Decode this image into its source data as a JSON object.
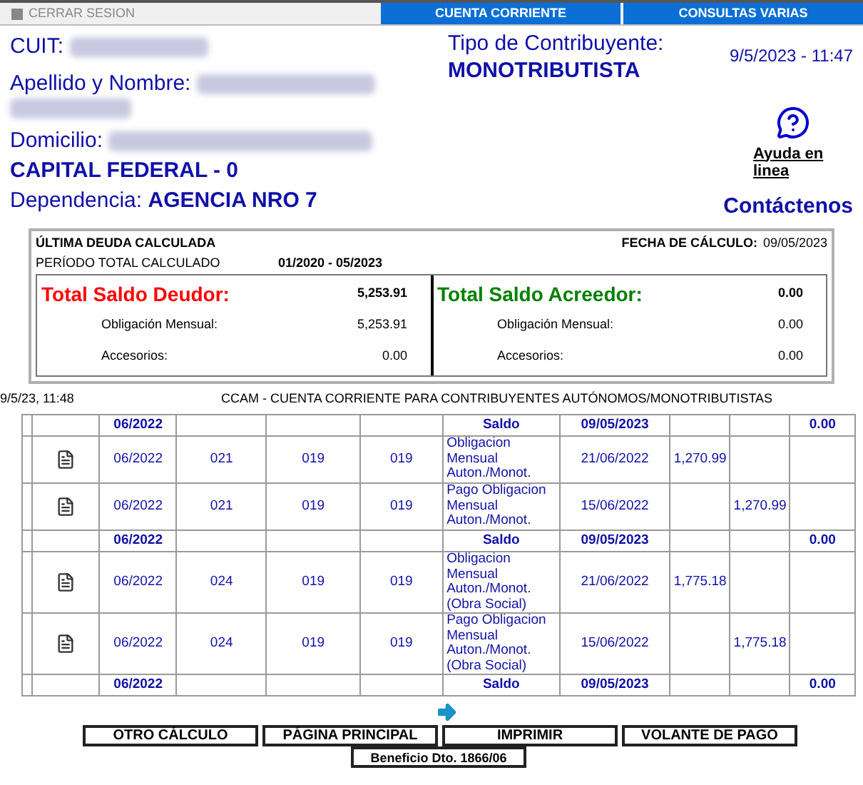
{
  "top_bar": {
    "logout": "CERRAR SESION",
    "tabs": [
      "CUENTA CORRIENTE",
      "CONSULTAS VARIAS"
    ]
  },
  "header": {
    "cuit_label": "CUIT:",
    "tipo_label": "Tipo de Contribuyente:",
    "tipo_value": "MONOTRIBUTISTA",
    "datetime": "9/5/2023 - 11:47",
    "nombre_label": "Apellido y Nombre:",
    "domicilio_label": "Domicilio:",
    "domicilio_city": "CAPITAL FEDERAL - 0",
    "help_link": "Ayuda en linea",
    "dependencia_label": "Dependencia:",
    "dependencia_value": "AGENCIA NRO 7",
    "contact_link": "Contáctenos"
  },
  "summary": {
    "title": "ÚLTIMA DEUDA CALCULADA",
    "date_label": "FECHA DE CÁLCULO:",
    "date_value": "09/05/2023",
    "period_label": "PERÍODO TOTAL CALCULADO",
    "period_value": "01/2020 - 05/2023",
    "panels": [
      {
        "title": "Total Saldo Deudor:",
        "color": "#ff0000",
        "total": "5,253.91",
        "lines": [
          {
            "label": "Obligación Mensual:",
            "value": "5,253.91"
          },
          {
            "label": "Accesorios:",
            "value": "0.00"
          }
        ]
      },
      {
        "title": "Total Saldo Acreedor:",
        "color": "#008000",
        "total": "0.00",
        "lines": [
          {
            "label": "Obligación Mensual:",
            "value": "0.00"
          },
          {
            "label": "Accesorios:",
            "value": "0.00"
          }
        ]
      }
    ]
  },
  "report": {
    "printed_at": "9/5/23, 11:48",
    "title": "CCAM - CUENTA CORRIENTE PARA CONTRIBUYENTES AUTÓNOMOS/MONOTRIBUTISTAS"
  },
  "table": {
    "rows": [
      {
        "kind": "saldo",
        "period": "06/2022",
        "label": "Saldo",
        "date": "09/05/2023",
        "balance": "0.00"
      },
      {
        "kind": "movement",
        "period": "06/2022",
        "column_3": "021",
        "column_4": "019",
        "column_5": "019",
        "description": "Obligacion Mensual Auton./Monot.",
        "date": "21/06/2022",
        "debit": "1,270.99"
      },
      {
        "kind": "movement",
        "period": "06/2022",
        "column_3": "021",
        "column_4": "019",
        "column_5": "019",
        "description": "Pago Obligacion Mensual Auton./Monot.",
        "date": "15/06/2022",
        "credit": "1,270.99"
      },
      {
        "kind": "saldo",
        "period": "06/2022",
        "label": "Saldo",
        "date": "09/05/2023",
        "balance": "0.00"
      },
      {
        "kind": "movement",
        "period": "06/2022",
        "column_3": "024",
        "column_4": "019",
        "column_5": "019",
        "description": "Obligacion Mensual Auton./Monot. (Obra Social)",
        "date": "21/06/2022",
        "debit": "1,775.18"
      },
      {
        "kind": "movement",
        "period": "06/2022",
        "column_3": "024",
        "column_4": "019",
        "column_5": "019",
        "description": "Pago Obligacion Mensual Auton./Monot. (Obra Social)",
        "date": "15/06/2022",
        "credit": "1,775.18"
      },
      {
        "kind": "saldo",
        "period": "06/2022",
        "label": "Saldo",
        "date": "09/05/2023",
        "balance": "0.00"
      }
    ]
  },
  "buttons": [
    "OTRO CÁLCULO",
    "PÁGINA PRINCIPAL",
    "IMPRIMIR",
    "VOLANTE DE PAGO"
  ],
  "footer_button": "Beneficio Dto. 1866/06"
}
